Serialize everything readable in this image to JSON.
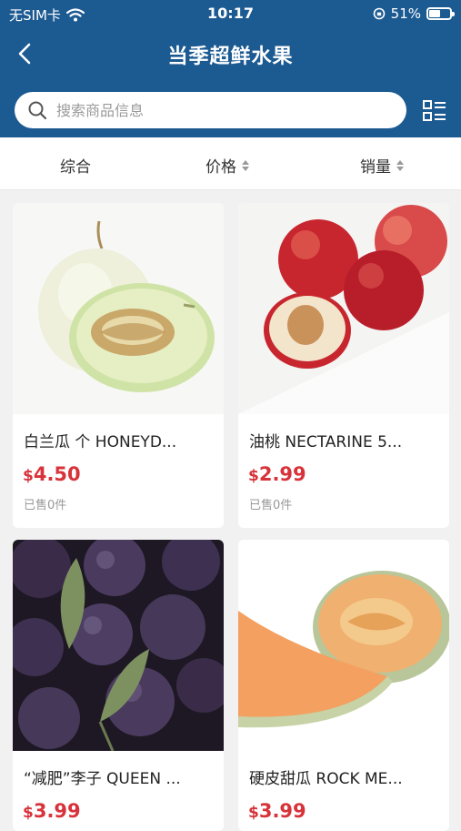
{
  "status": {
    "carrier": "无SIM卡",
    "time": "10:17",
    "battery_text": "51%",
    "battery_level": 0.51
  },
  "nav": {
    "title": "当季超鲜水果"
  },
  "search": {
    "placeholder": "搜索商品信息",
    "value": ""
  },
  "sort": [
    {
      "label": "综合"
    },
    {
      "label": "价格"
    },
    {
      "label": "销量"
    }
  ],
  "products": [
    {
      "name": "白兰瓜 个 HONEYD...",
      "currency": "$",
      "price": "4.50",
      "sold": "已售0件"
    },
    {
      "name": "油桃 NECTARINE 5...",
      "currency": "$",
      "price": "2.99",
      "sold": "已售0件"
    },
    {
      "name": "“减肥”李子 QUEEN ...",
      "currency": "$",
      "price": "3.99",
      "sold": ""
    },
    {
      "name": "硬皮甜瓜 ROCK ME...",
      "currency": "$",
      "price": "3.99",
      "sold": ""
    }
  ],
  "colors": {
    "header": "#1c5a92",
    "price": "#d8323a"
  }
}
